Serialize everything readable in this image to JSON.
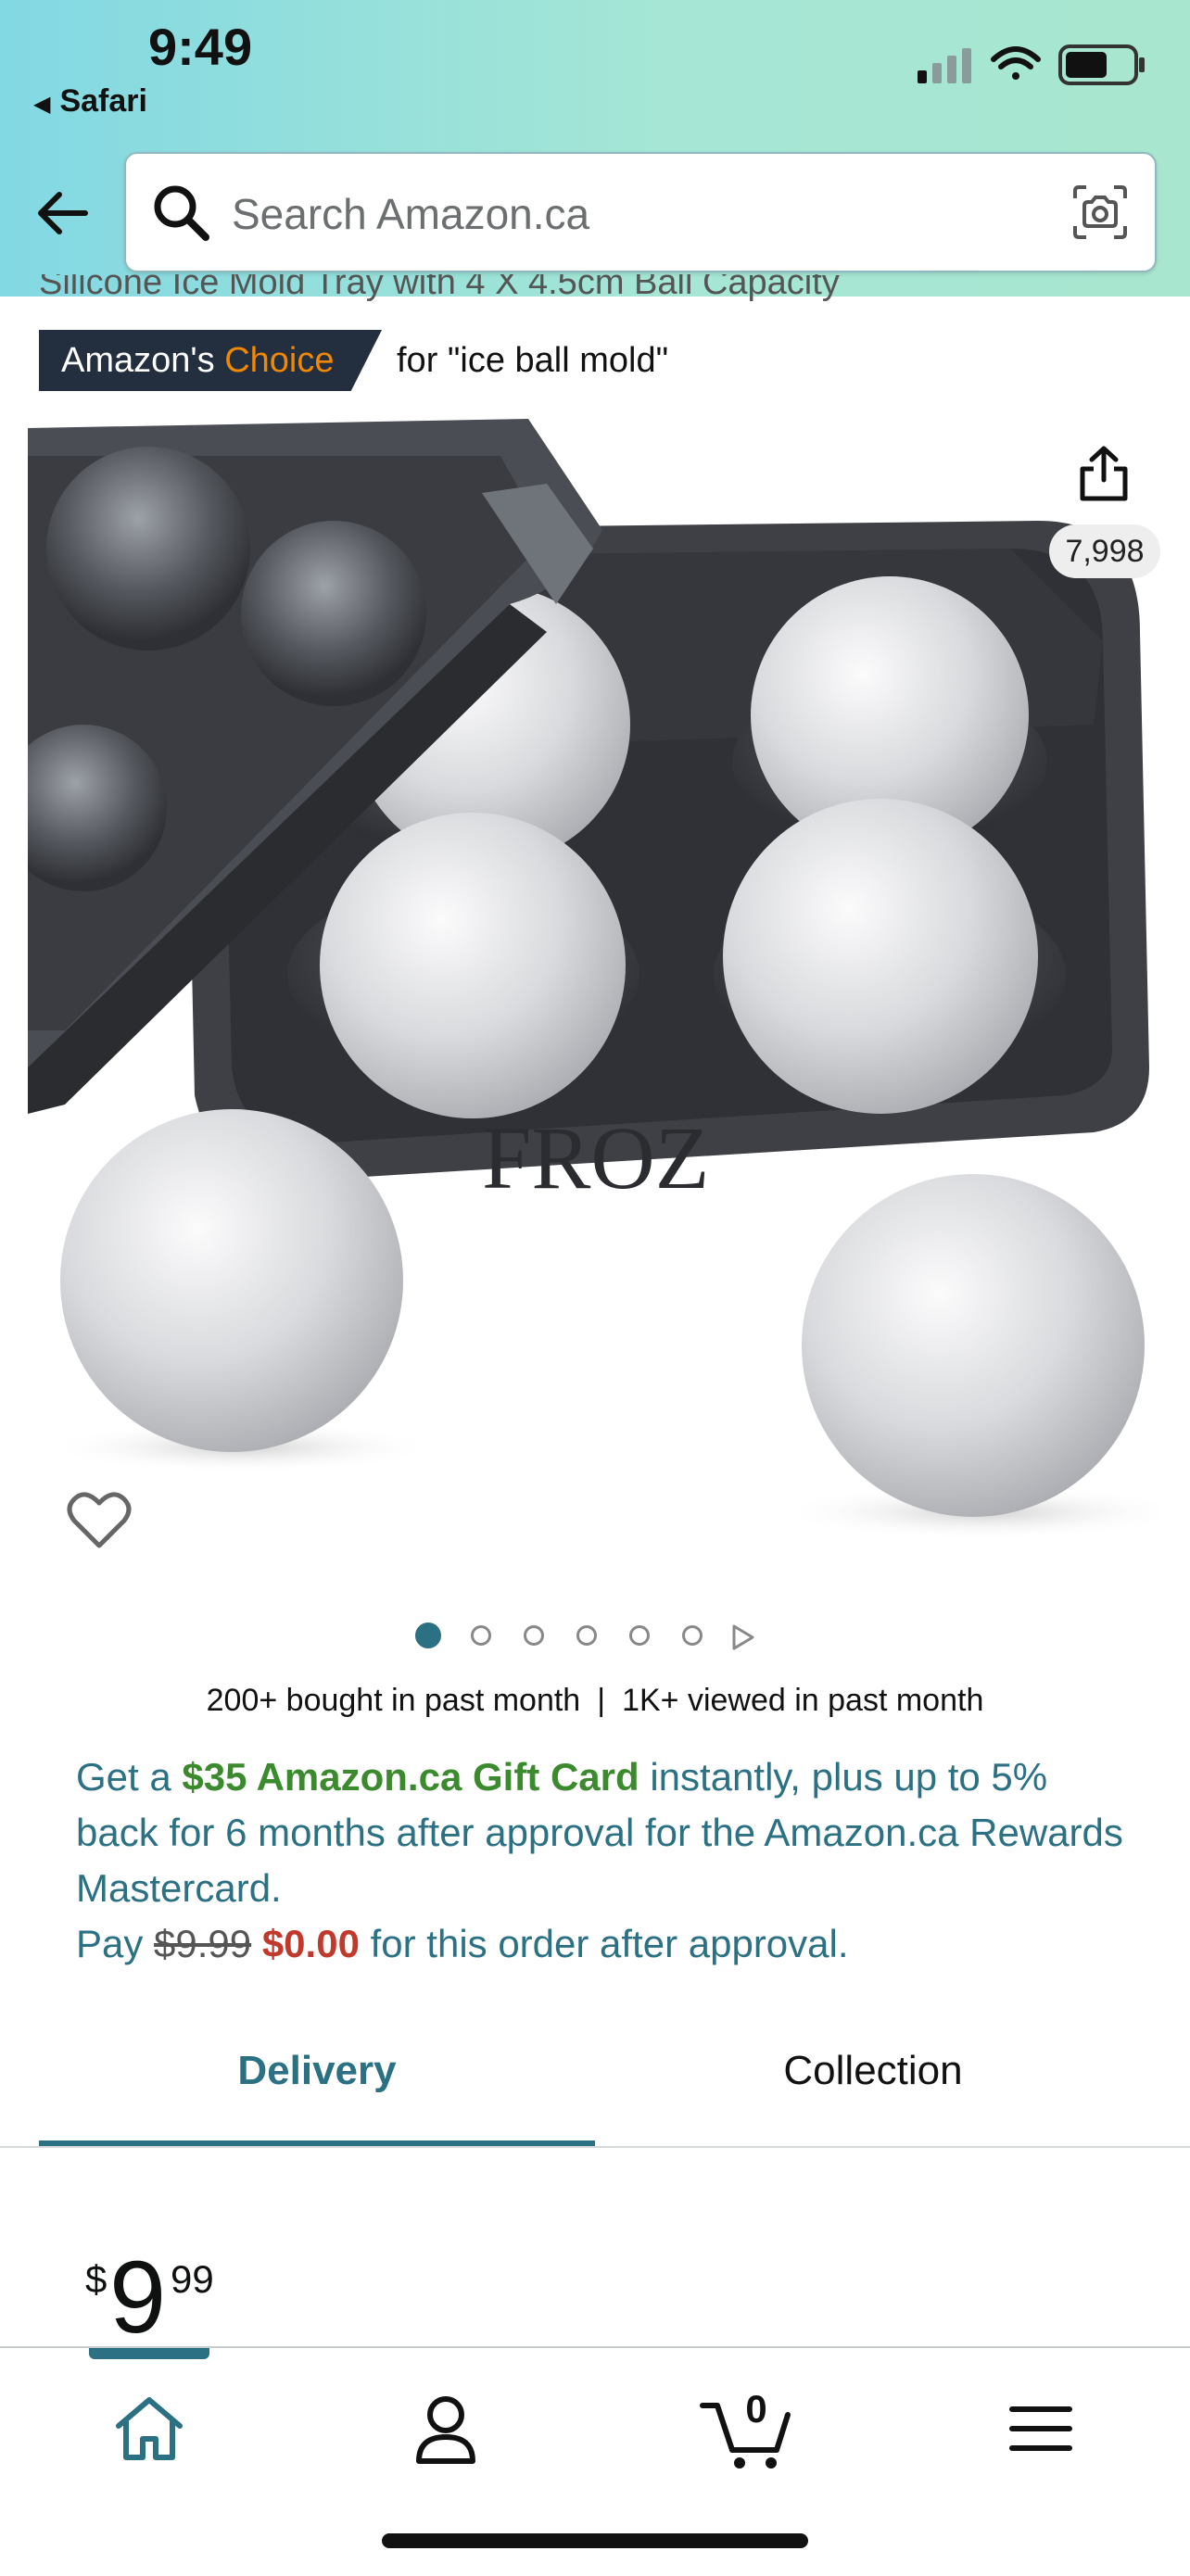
{
  "status_bar": {
    "time": "9:49",
    "back_app": "Safari"
  },
  "search": {
    "placeholder": "Search Amazon.ca"
  },
  "product": {
    "title_partial": "Silicone Ice Mold Tray with 4 X 4.5cm Ball Capacity",
    "badge": {
      "prefix": "Amazon's ",
      "highlight": "Choice",
      "for_text": "for \"ice ball mold\""
    },
    "ratings_count": "7,998",
    "image_brand_text": "FROZ"
  },
  "carousel": {
    "total_dots": 6,
    "active_index": 0
  },
  "social_proof": {
    "bought": "200+ bought in past month",
    "separator": "|",
    "viewed": "1K+ viewed in past month"
  },
  "promo": {
    "part1": "Get a ",
    "gift_card": "$35 Amazon.ca Gift Card",
    "part2": " instantly, plus up to 5% back for 6 months after approval for the Amazon.ca Rewards Mastercard.",
    "pay_label": "Pay ",
    "old_price": "$9.99",
    "new_price": "$0.00",
    "pay_suffix": " for this order after approval."
  },
  "tabs": {
    "delivery": "Delivery",
    "collection": "Collection",
    "active": "delivery"
  },
  "price": {
    "symbol": "$",
    "whole": "9",
    "fraction": "99"
  },
  "bottom_nav": {
    "cart_count": "0",
    "items": [
      "home-icon",
      "account-icon",
      "cart-icon",
      "menu-icon"
    ],
    "active": "home-icon"
  },
  "colors": {
    "accent": "#2b7083",
    "badge_bg": "#232f3e",
    "badge_highlight": "#f08804",
    "promo_green": "#3c8a2e",
    "promo_red": "#c0392b"
  }
}
